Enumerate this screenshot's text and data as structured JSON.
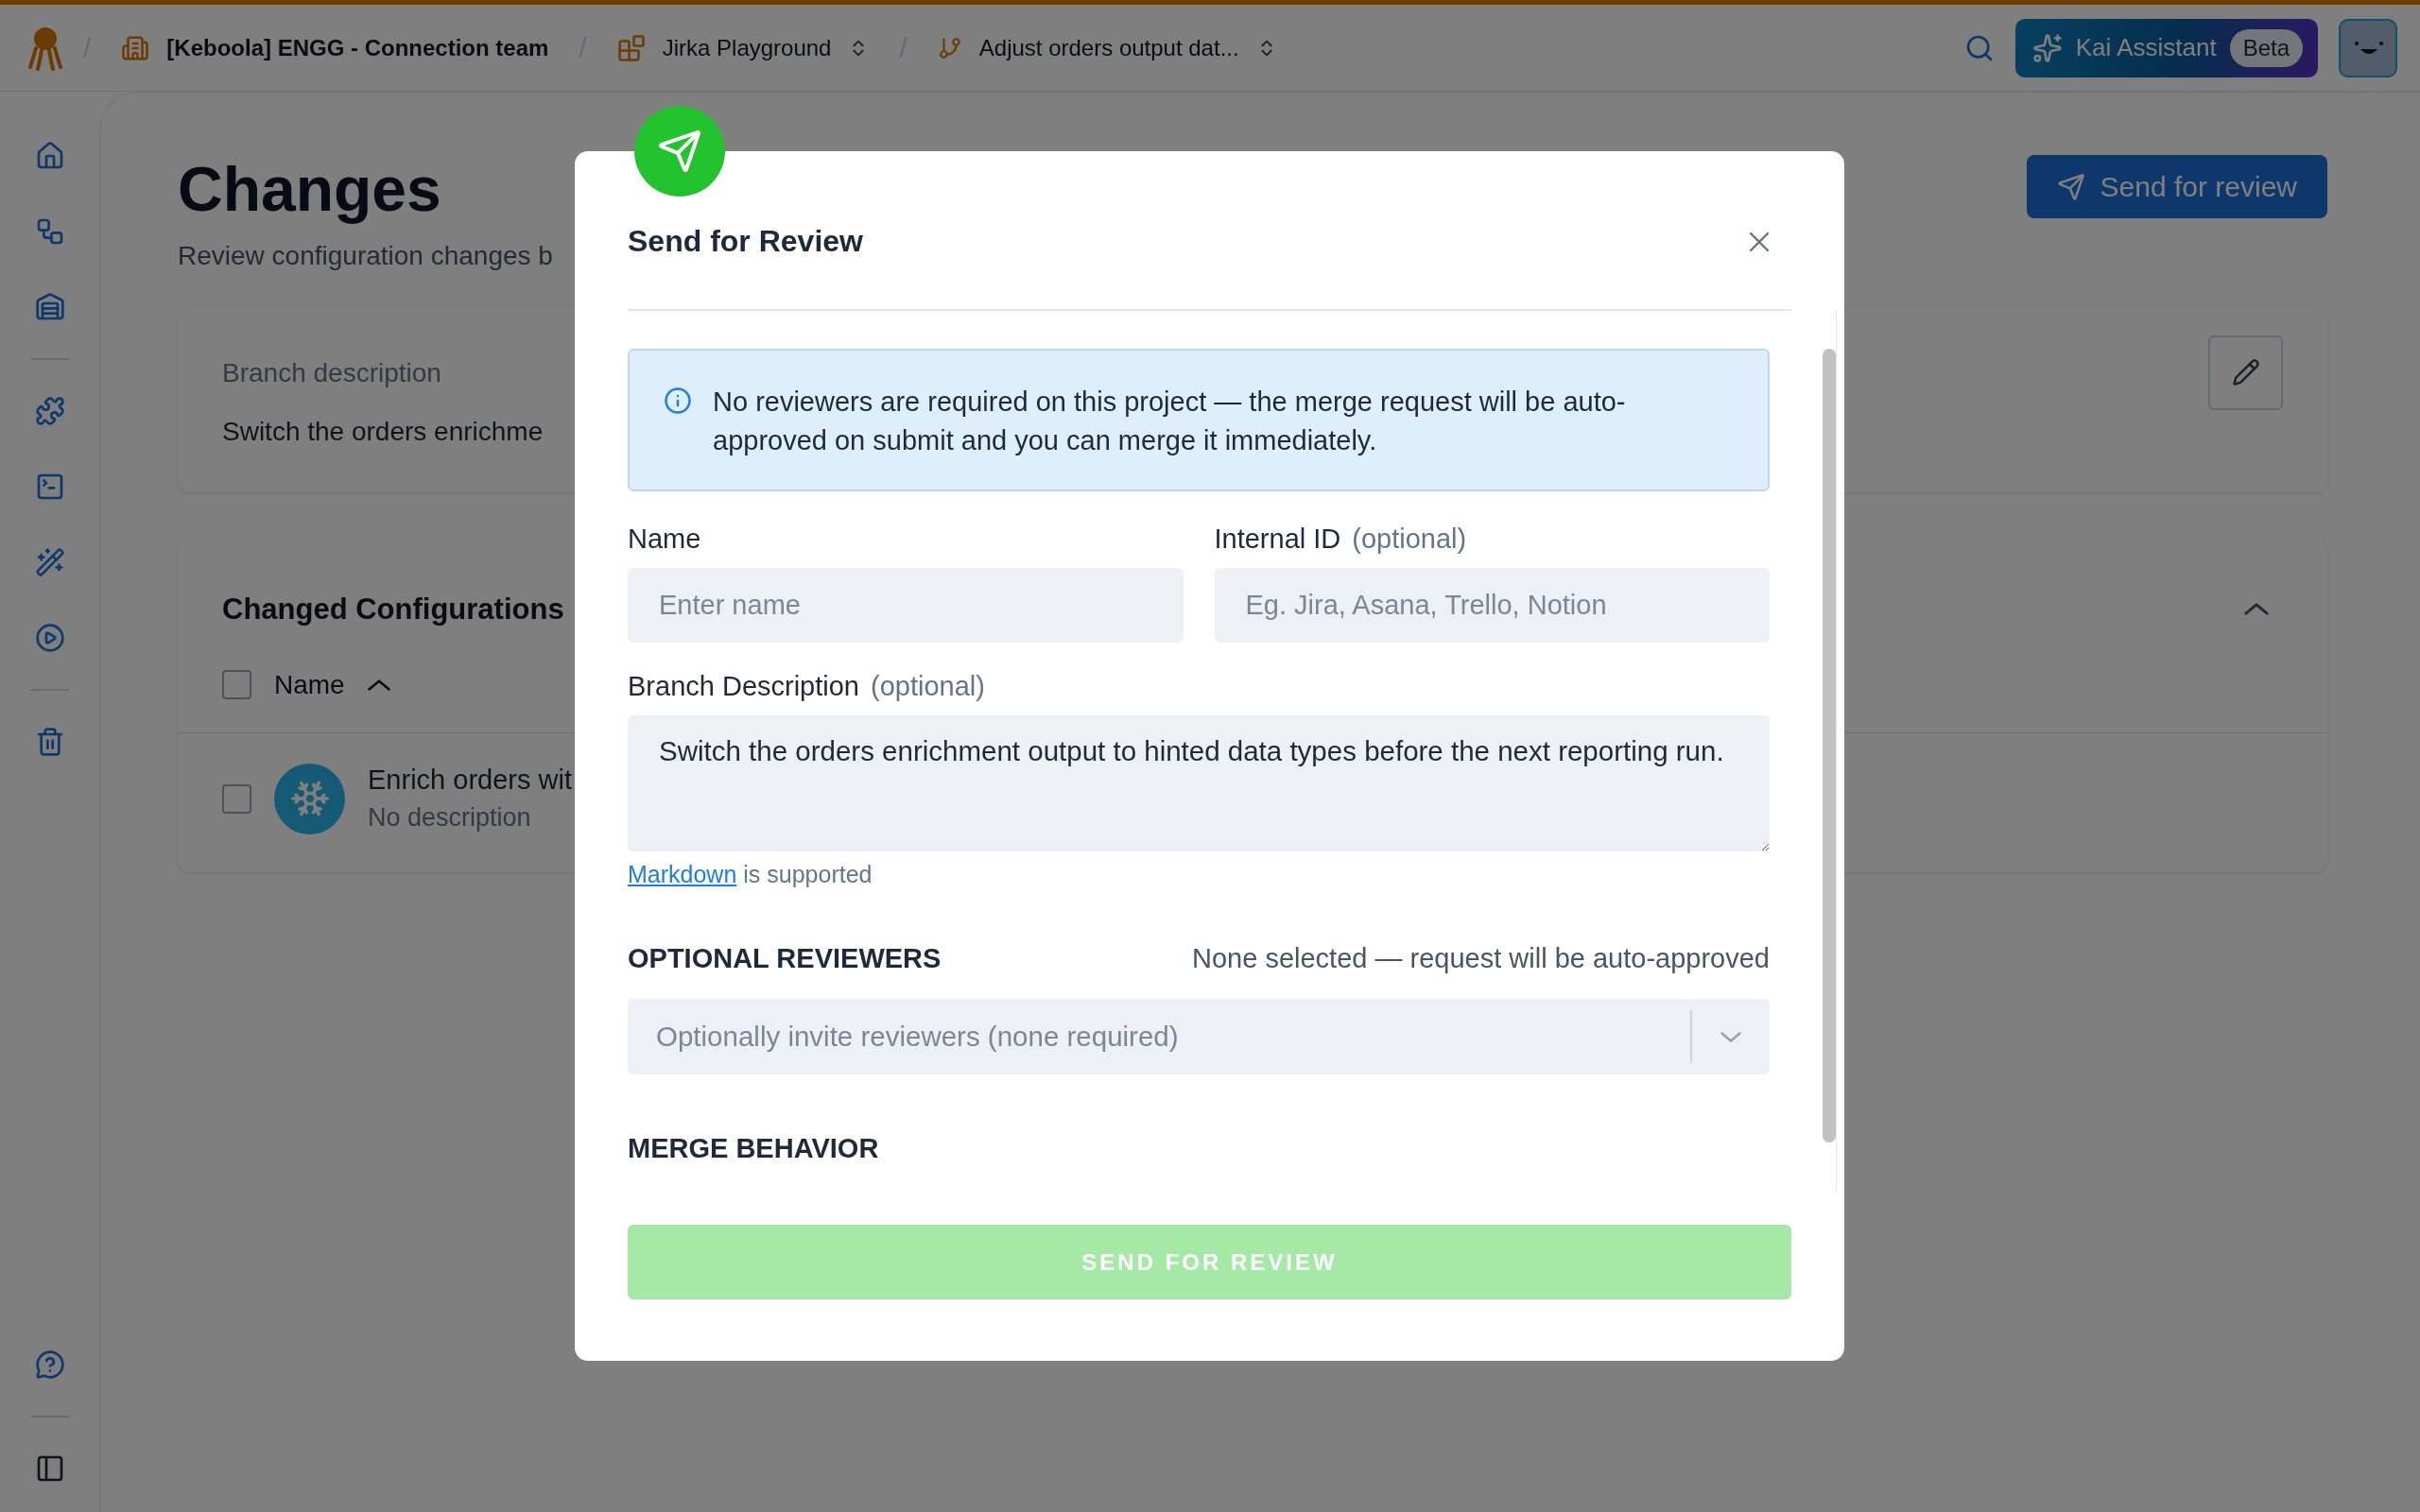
{
  "topbar": {
    "separator": "/",
    "breadcrumbs": [
      {
        "kind": "org",
        "label": "[Keboola] ENGG - Connection team"
      },
      {
        "kind": "project",
        "label": "Jirka Playground"
      },
      {
        "kind": "branch",
        "label": "Adjust orders output dat..."
      }
    ],
    "assistant": {
      "label": "Kai Assistant",
      "badge": "Beta"
    }
  },
  "page": {
    "title": "Changes",
    "subtitle": "Review configuration changes b",
    "action": "Send for review",
    "branch_card": {
      "label": "Branch description",
      "text": "Switch the orders enrichme"
    },
    "configs": {
      "title": "Changed Configurations",
      "column": "Name",
      "header_checked": false,
      "rows": [
        {
          "name": "Enrich orders wit",
          "description": "No description",
          "checked": false
        }
      ]
    }
  },
  "dialog": {
    "title": "Send for Review",
    "notice": "No reviewers are required on this project — the merge request will be auto-approved on submit and you can merge it immediately.",
    "fields": [
      {
        "label": "Name",
        "placeholder": "Enter name"
      },
      {
        "label": "Internal ID",
        "hint": "(optional)",
        "placeholder": "Eg. Jira, Asana, Trello, Notion"
      }
    ],
    "description": {
      "label": "Branch Description",
      "hint": "(optional)",
      "value": "Switch the orders enrichment output to hinted data types before the next reporting run.",
      "help_link": "Markdown",
      "help_text": "is supported"
    },
    "reviewers": {
      "title": "OPTIONAL REVIEWERS",
      "status": "None selected — request will be auto-approved",
      "placeholder": "Optionally invite reviewers (none required)"
    },
    "merge": {
      "title": "MERGE BEHAVIOR"
    },
    "submit": {
      "label": "SEND FOR REVIEW",
      "disabled": true
    }
  }
}
